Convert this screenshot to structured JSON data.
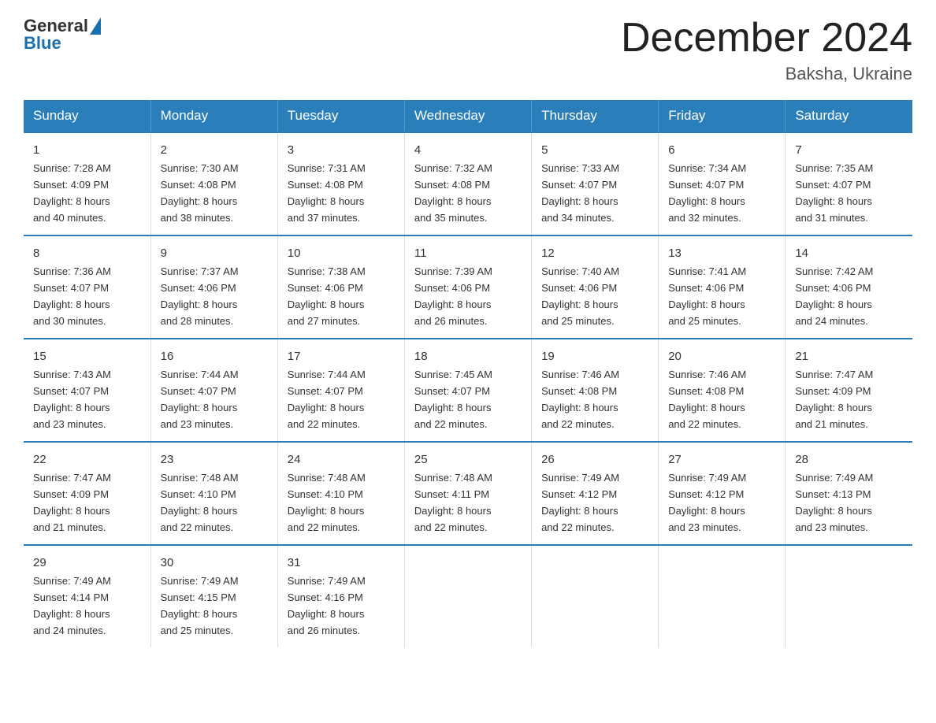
{
  "header": {
    "logo_general": "General",
    "logo_blue": "Blue",
    "month_title": "December 2024",
    "location": "Baksha, Ukraine"
  },
  "weekdays": [
    "Sunday",
    "Monday",
    "Tuesday",
    "Wednesday",
    "Thursday",
    "Friday",
    "Saturday"
  ],
  "weeks": [
    [
      {
        "day": "1",
        "sunrise": "7:28 AM",
        "sunset": "4:09 PM",
        "daylight": "8 hours and 40 minutes."
      },
      {
        "day": "2",
        "sunrise": "7:30 AM",
        "sunset": "4:08 PM",
        "daylight": "8 hours and 38 minutes."
      },
      {
        "day": "3",
        "sunrise": "7:31 AM",
        "sunset": "4:08 PM",
        "daylight": "8 hours and 37 minutes."
      },
      {
        "day": "4",
        "sunrise": "7:32 AM",
        "sunset": "4:08 PM",
        "daylight": "8 hours and 35 minutes."
      },
      {
        "day": "5",
        "sunrise": "7:33 AM",
        "sunset": "4:07 PM",
        "daylight": "8 hours and 34 minutes."
      },
      {
        "day": "6",
        "sunrise": "7:34 AM",
        "sunset": "4:07 PM",
        "daylight": "8 hours and 32 minutes."
      },
      {
        "day": "7",
        "sunrise": "7:35 AM",
        "sunset": "4:07 PM",
        "daylight": "8 hours and 31 minutes."
      }
    ],
    [
      {
        "day": "8",
        "sunrise": "7:36 AM",
        "sunset": "4:07 PM",
        "daylight": "8 hours and 30 minutes."
      },
      {
        "day": "9",
        "sunrise": "7:37 AM",
        "sunset": "4:06 PM",
        "daylight": "8 hours and 28 minutes."
      },
      {
        "day": "10",
        "sunrise": "7:38 AM",
        "sunset": "4:06 PM",
        "daylight": "8 hours and 27 minutes."
      },
      {
        "day": "11",
        "sunrise": "7:39 AM",
        "sunset": "4:06 PM",
        "daylight": "8 hours and 26 minutes."
      },
      {
        "day": "12",
        "sunrise": "7:40 AM",
        "sunset": "4:06 PM",
        "daylight": "8 hours and 25 minutes."
      },
      {
        "day": "13",
        "sunrise": "7:41 AM",
        "sunset": "4:06 PM",
        "daylight": "8 hours and 25 minutes."
      },
      {
        "day": "14",
        "sunrise": "7:42 AM",
        "sunset": "4:06 PM",
        "daylight": "8 hours and 24 minutes."
      }
    ],
    [
      {
        "day": "15",
        "sunrise": "7:43 AM",
        "sunset": "4:07 PM",
        "daylight": "8 hours and 23 minutes."
      },
      {
        "day": "16",
        "sunrise": "7:44 AM",
        "sunset": "4:07 PM",
        "daylight": "8 hours and 23 minutes."
      },
      {
        "day": "17",
        "sunrise": "7:44 AM",
        "sunset": "4:07 PM",
        "daylight": "8 hours and 22 minutes."
      },
      {
        "day": "18",
        "sunrise": "7:45 AM",
        "sunset": "4:07 PM",
        "daylight": "8 hours and 22 minutes."
      },
      {
        "day": "19",
        "sunrise": "7:46 AM",
        "sunset": "4:08 PM",
        "daylight": "8 hours and 22 minutes."
      },
      {
        "day": "20",
        "sunrise": "7:46 AM",
        "sunset": "4:08 PM",
        "daylight": "8 hours and 22 minutes."
      },
      {
        "day": "21",
        "sunrise": "7:47 AM",
        "sunset": "4:09 PM",
        "daylight": "8 hours and 21 minutes."
      }
    ],
    [
      {
        "day": "22",
        "sunrise": "7:47 AM",
        "sunset": "4:09 PM",
        "daylight": "8 hours and 21 minutes."
      },
      {
        "day": "23",
        "sunrise": "7:48 AM",
        "sunset": "4:10 PM",
        "daylight": "8 hours and 22 minutes."
      },
      {
        "day": "24",
        "sunrise": "7:48 AM",
        "sunset": "4:10 PM",
        "daylight": "8 hours and 22 minutes."
      },
      {
        "day": "25",
        "sunrise": "7:48 AM",
        "sunset": "4:11 PM",
        "daylight": "8 hours and 22 minutes."
      },
      {
        "day": "26",
        "sunrise": "7:49 AM",
        "sunset": "4:12 PM",
        "daylight": "8 hours and 22 minutes."
      },
      {
        "day": "27",
        "sunrise": "7:49 AM",
        "sunset": "4:12 PM",
        "daylight": "8 hours and 23 minutes."
      },
      {
        "day": "28",
        "sunrise": "7:49 AM",
        "sunset": "4:13 PM",
        "daylight": "8 hours and 23 minutes."
      }
    ],
    [
      {
        "day": "29",
        "sunrise": "7:49 AM",
        "sunset": "4:14 PM",
        "daylight": "8 hours and 24 minutes."
      },
      {
        "day": "30",
        "sunrise": "7:49 AM",
        "sunset": "4:15 PM",
        "daylight": "8 hours and 25 minutes."
      },
      {
        "day": "31",
        "sunrise": "7:49 AM",
        "sunset": "4:16 PM",
        "daylight": "8 hours and 26 minutes."
      },
      null,
      null,
      null,
      null
    ]
  ],
  "labels": {
    "sunrise": "Sunrise:",
    "sunset": "Sunset:",
    "daylight": "Daylight:"
  }
}
